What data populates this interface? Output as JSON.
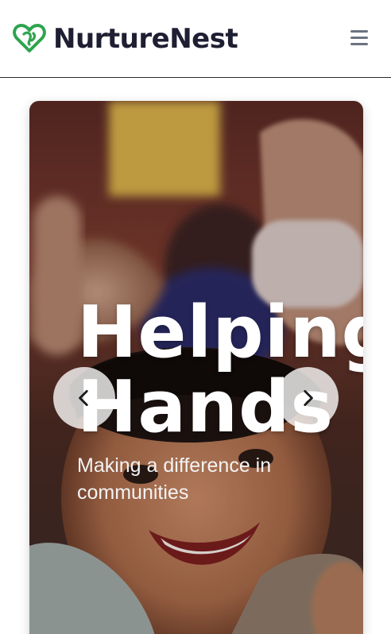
{
  "header": {
    "brand": "NurtureNest",
    "logo_icon": "heart-outline-icon",
    "menu_icon": "hamburger-menu-icon",
    "brand_color": "#1f1f33",
    "logo_color": "#2ea44f"
  },
  "hero": {
    "title": "Helping\nHands",
    "subtitle": "Making a difference in communities",
    "prev_icon": "chevron-left-icon",
    "next_icon": "chevron-right-icon"
  }
}
